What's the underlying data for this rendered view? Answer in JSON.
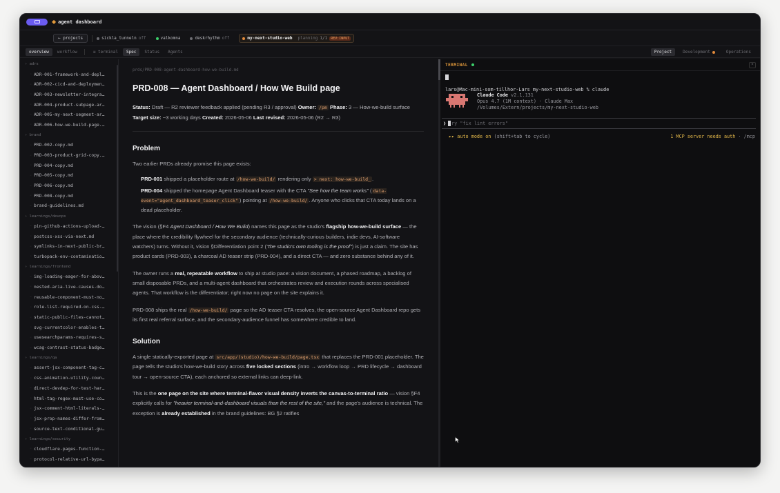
{
  "app": {
    "title": "agent dashboard"
  },
  "projects_bar": {
    "projects_btn": "← projects",
    "tabs": [
      {
        "label": "sickla_tunneln",
        "status": "off",
        "dot": "#6d6d73"
      },
      {
        "label": "valkomna",
        "status": "",
        "dot": "#3ccf6a"
      },
      {
        "label": "deskrhythm",
        "status": "off",
        "dot": "#6d6d73"
      }
    ],
    "active": {
      "label": "my-next-studio-web",
      "planning": "planning",
      "fraction": "1/1",
      "review": "REV:INPUT",
      "dot": "#e38a3b"
    }
  },
  "view_tabs": {
    "overview": "overview",
    "workflow": "workflow",
    "terminal": "≡ terminal",
    "spec": "Spec",
    "status": "Status",
    "agents": "Agents",
    "project": "Project",
    "development": "Development",
    "operations": "Operations"
  },
  "sidebar": [
    {
      "group": "› adrs",
      "items": [
        "ADR-001-framework-and-depl…",
        "ADR-002-cicd-and-deploymen…",
        "ADR-003-newsletter-integra…",
        "ADR-004-product-subpage-ar…",
        "ADR-005-my-next-segment-ar…",
        "ADR-006-how-we-build-page.…"
      ]
    },
    {
      "group": "› brand",
      "items": [
        "PRD-002-copy.md",
        "PRD-003-product-grid-copy.…",
        "PRD-004-copy.md",
        "PRD-005-copy.md",
        "PRD-006-copy.md",
        "PRD-008-copy.md",
        "brand-guidelines.md"
      ]
    },
    {
      "group": "› learnings/devops",
      "items": [
        "pin-github-actions-upload-…",
        "postcss-xss-via-next.md",
        "symlinks-in-next-public-br…",
        "turbopack-env-contaminatio…"
      ]
    },
    {
      "group": "› learnings/frontend",
      "items": [
        "img-loading-eager-for-abov…",
        "nested-aria-live-causes-do…",
        "reusable-component-must-no…",
        "role-list-required-on-css-…",
        "static-public-files-cannot…",
        "svg-currentcolor-enables-t…",
        "usesearchparams-requires-s…",
        "wcag-contrast-status-badge…"
      ]
    },
    {
      "group": "› learnings/qa",
      "items": [
        "assert-jsx-component-tag-c…",
        "css-animation-utility-coun…",
        "direct-devdep-for-test-har…",
        "html-tag-regex-must-use-co…",
        "jsx-comment-html-literals-…",
        "jsx-prop-names-differ-from…",
        "source-text-conditional-gu…"
      ]
    },
    {
      "group": "› learnings/security",
      "items": [
        "cloudflare-pages-function-…",
        "protocol-relative-url-bypa…",
        "typescript-template-litera…"
      ]
    }
  ],
  "doc": {
    "path": "prds/PRD-008-agent-dashboard-how-we-build.md",
    "title": "PRD-008 — Agent Dashboard / How We Build page",
    "meta": {
      "status_label": "Status:",
      "status": " Draft — R2 reviewer feedback applied (pending R3 / approval) ",
      "owner_label": "Owner:",
      "owner": "/pm",
      "phase_label": "Phase:",
      "phase": " 3 — How-we-build surface ",
      "target_label": "Target size:",
      "target": " ~3 working days ",
      "created_label": "Created:",
      "created": " 2026-05-06 ",
      "revised_label": "Last revised:",
      "revised": " 2026-05-06 (R2 → R3)"
    },
    "problem_heading": "Problem",
    "p1": "Two earlier PRDs already promise this page exists:",
    "prd001": {
      "b": "PRD-001",
      "t1": " shipped a placeholder route at ",
      "c1": "/how-we-build/",
      "t2": " rendering only ",
      "c2": "> next: how-we-build_",
      "t3": "."
    },
    "prd004": {
      "b": "PRD-004",
      "t1": " shipped the homepage Agent Dashboard teaser with the CTA ",
      "i": "\"See how the team works\"",
      "t2": " (",
      "c1": "data-event=\"agent_dashboard_teaser_click\"",
      "t3": ") pointing at ",
      "c2": "/how-we-build/",
      "t4": ". Anyone who clicks that CTA today lands on a dead placeholder."
    },
    "p2": {
      "t1": "The vision (§F4 ",
      "i1": "Agent Dashboard / How We Build",
      "t2": ") names this page as the studio's ",
      "b1": "flagship how-we-build surface",
      "t3": " — the place where the credibility flywheel for the secondary audience (technically-curious builders, indie devs, AI-software watchers) turns. Without it, vision §Differentiation point 2 (",
      "i2": "\"the studio's own tooling is the proof\"",
      "t4": ") is just a claim. The site has product cards (PRD-003), a charcoal AD teaser strip (PRD-004), and a direct CTA — and zero substance behind any of it."
    },
    "p3": {
      "t1": "The owner runs a ",
      "b1": "real, repeatable workflow",
      "t2": " to ship at studio pace: a vision document, a phased roadmap, a backlog of small disposable PRDs, and a multi-agent dashboard that orchestrates review and execution rounds across specialised agents. That workflow is the differentiator; right now no page on the site explains it."
    },
    "p4": {
      "t1": "PRD-008 ships the real ",
      "c1": "/how-we-build/",
      "t2": " page so the AD teaser CTA resolves, the open-source Agent Dashboard repo gets its first real referral surface, and the secondary-audience funnel has somewhere credible to land."
    },
    "solution_heading": "Solution",
    "p5": {
      "t1": "A single statically-exported page at ",
      "c1": "src/app/(studio)/how-we-build/page.tsx",
      "t2": " that replaces the PRD-001 placeholder. The page tells the studio's how-we-build story across ",
      "b1": "five locked sections",
      "t2b": " (intro → workflow loop → PRD lifecycle → dashboard tour → open-source CTA), each anchored so external links can deep-link."
    },
    "p6": {
      "t1": "This is the ",
      "b1": "one page on the site where terminal-flavor visual density inverts the canvas-to-terminal ratio",
      "t2": " — vision §F4 explicitly calls for ",
      "i1": "\"heavier terminal-and-dashboard visuals than the rest of the site,\"",
      "t3": " and the page's audience is technical. The exception is ",
      "b2": "already established",
      "t4": " in the brand guidelines: BG §2 ratifies"
    }
  },
  "terminal": {
    "label": "TERMINAL",
    "close": "×",
    "cmd": "lars@Mac-mini-som-tillhor-Lars my-next-studio-web % claude",
    "cc_name": "Claude Code",
    "cc_version": " v2.1.131",
    "cc_model": "Opus 4.7 (1M context) · Claude Max",
    "cc_path": "/Volumes/Extern/projects/my-next-studio-web",
    "prompt_hint": "ry \"fix lint errors\"",
    "mode_prefix": "▸▸ auto mode on",
    "mode_suffix": " (shift+tab to cycle)",
    "mcp_text": "1 MCP server needs auth",
    "mcp_suffix": " · /mcp"
  },
  "colors": {
    "accent": "#6b5cf0",
    "terminal_label": "#e39a3b",
    "online": "#3ccf6a",
    "code": "#e0a070"
  }
}
